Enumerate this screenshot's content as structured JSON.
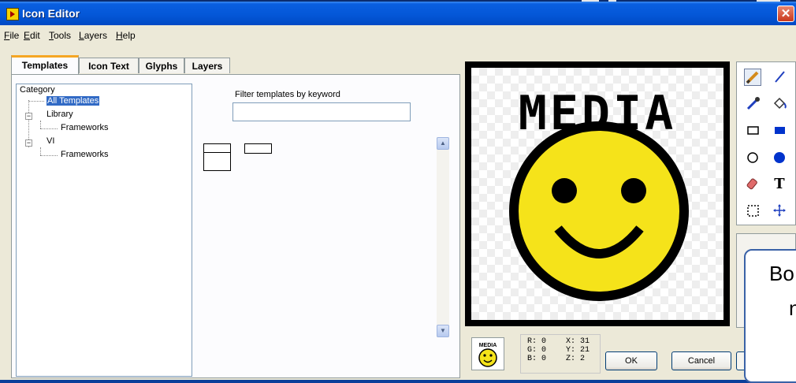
{
  "window": {
    "title": "Icon Editor",
    "close_glyph": "✕"
  },
  "menu": [
    {
      "accel": "F",
      "rest": "ile"
    },
    {
      "accel": "E",
      "rest": "dit"
    },
    {
      "accel": "T",
      "rest": "ools"
    },
    {
      "accel": "L",
      "rest": "ayers"
    },
    {
      "accel": "H",
      "rest": "elp"
    }
  ],
  "tabs": [
    {
      "label": "Templates",
      "active": true
    },
    {
      "label": "Icon Text",
      "active": false
    },
    {
      "label": "Glyphs",
      "active": false
    },
    {
      "label": "Layers",
      "active": false
    }
  ],
  "tree": {
    "header": "Category",
    "items": [
      {
        "label": "All Templates",
        "selected": true
      },
      {
        "label": "Library",
        "expander": "−"
      },
      {
        "label": "Frameworks"
      },
      {
        "label": "VI",
        "expander": "−"
      },
      {
        "label": "Frameworks"
      }
    ]
  },
  "filter": {
    "label": "Filter templates by keyword",
    "value": ""
  },
  "canvas": {
    "text": "MEDIA"
  },
  "tools": [
    "pencil-icon",
    "line-icon",
    "dropper-icon",
    "fill-bucket-icon",
    "rectangle-icon",
    "filled-rectangle-icon",
    "ellipse-icon",
    "filled-ellipse-icon",
    "eraser-icon",
    "text-icon",
    "selection-icon",
    "move-icon"
  ],
  "tool_text_glyph": "T",
  "readout": {
    "r": "R: 0",
    "g": "G: 0",
    "b": "B: 0",
    "x": "X: 31",
    "y": "Y: 21",
    "z": "Z: 2"
  },
  "buttons": {
    "ok": "OK",
    "cancel": "Cancel"
  },
  "callout": {
    "line1": "Bo",
    "line2": "n"
  },
  "colors": {
    "title_bar": "#0457d8",
    "selection": "#316ac5",
    "smiley": "#f5e31a"
  }
}
